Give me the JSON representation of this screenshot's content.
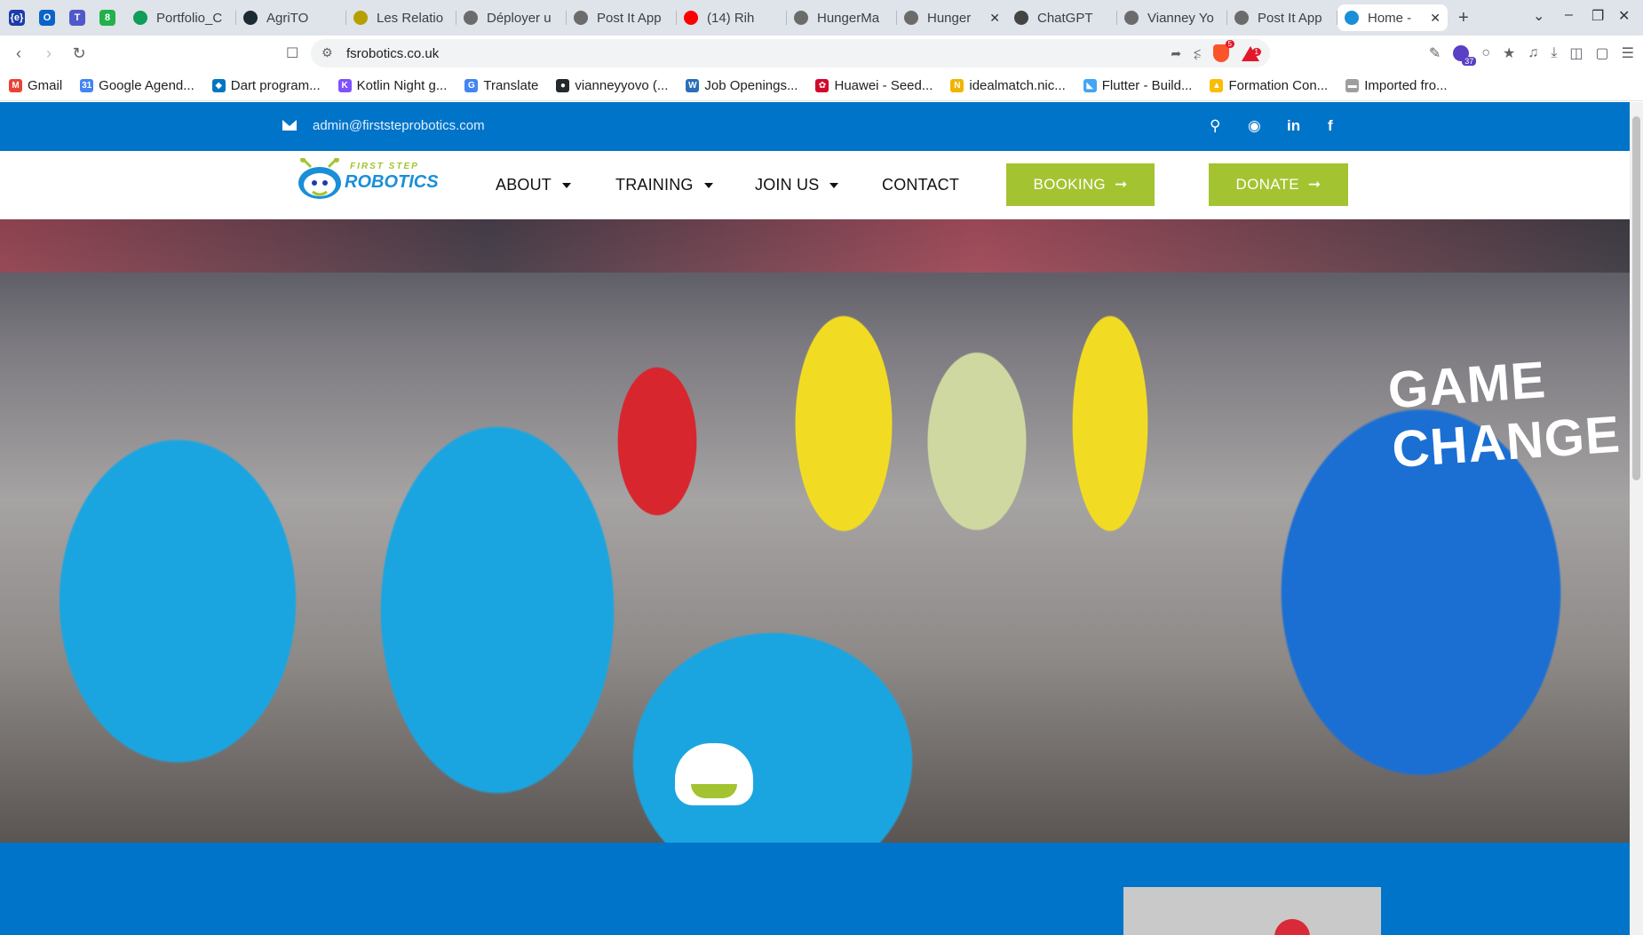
{
  "browser": {
    "pinned_tabs": [
      {
        "name": "pinned-tab-1",
        "icon": "braces-icon",
        "color": "#1a3da8",
        "glyph": "{e}"
      },
      {
        "name": "pinned-tab-2",
        "icon": "outlook-icon",
        "color": "#0a64c8",
        "glyph": "O"
      },
      {
        "name": "pinned-tab-3",
        "icon": "teams-icon",
        "color": "#5059c9",
        "glyph": "T"
      },
      {
        "name": "pinned-tab-4",
        "icon": "green-badge-icon",
        "color": "#22b14c",
        "glyph": "8"
      }
    ],
    "tabs": [
      {
        "label": "Portfolio_C",
        "icon": "sheets-icon",
        "color": "#0f9d58"
      },
      {
        "label": "AgriTO",
        "icon": "agrito-icon",
        "color": "#1b2a33"
      },
      {
        "label": "Les Relatio",
        "icon": "cube-icon",
        "color": "#b5a000"
      },
      {
        "label": "Déployer u",
        "icon": "globe-icon",
        "color": "#6b6b6b"
      },
      {
        "label": "Post It App",
        "icon": "globe-icon",
        "color": "#6b6b6b"
      },
      {
        "label": "(14) Rih",
        "icon": "youtube-icon",
        "color": "#ff0000"
      },
      {
        "label": "HungerMa",
        "icon": "globe-icon",
        "color": "#6b6b6b"
      },
      {
        "label": "Hunger",
        "icon": "globe-icon",
        "color": "#6b6b6b"
      },
      {
        "label": "ChatGPT",
        "icon": "chatgpt-icon",
        "color": "#444444"
      },
      {
        "label": "Vianney Yo",
        "icon": "globe-icon",
        "color": "#6b6b6b"
      },
      {
        "label": "Post It App",
        "icon": "globe-icon",
        "color": "#6b6b6b"
      },
      {
        "label": "Home -",
        "icon": "robot-icon",
        "color": "#1a8fd8"
      }
    ],
    "active_tab_index": 11,
    "new_tab_symbol": "+",
    "window_controls": {
      "dropdown": "⌄",
      "minimize": "–",
      "restore": "❐",
      "close": "✕"
    },
    "url": "fsrobotics.co.uk",
    "brave_shield_count": "5",
    "brave_rewards_count": "1",
    "extension_badge_count": "37",
    "bookmarks": [
      {
        "label": "Gmail",
        "icon": "gmail-icon",
        "color": "#ea4335",
        "glyph": "M"
      },
      {
        "label": "Google Agend...",
        "icon": "calendar-icon",
        "color": "#4285f4",
        "glyph": "31"
      },
      {
        "label": "Dart program...",
        "icon": "dart-icon",
        "color": "#0175c2",
        "glyph": "◆"
      },
      {
        "label": "Kotlin Night g...",
        "icon": "kotlin-icon",
        "color": "#7f52ff",
        "glyph": "K"
      },
      {
        "label": "Translate",
        "icon": "translate-icon",
        "color": "#4285f4",
        "glyph": "G"
      },
      {
        "label": "vianneyyovo (...",
        "icon": "github-icon",
        "color": "#24292e",
        "glyph": "●"
      },
      {
        "label": "Job Openings...",
        "icon": "wfp-icon",
        "color": "#2a6fb8",
        "glyph": "W"
      },
      {
        "label": "Huawei - Seed...",
        "icon": "huawei-icon",
        "color": "#cf0a2c",
        "glyph": "✿"
      },
      {
        "label": "idealmatch.nic...",
        "icon": "idealmatch-icon",
        "color": "#f0b400",
        "glyph": "N"
      },
      {
        "label": "Flutter - Build...",
        "icon": "flutter-icon",
        "color": "#42a5f5",
        "glyph": "◣"
      },
      {
        "label": "Formation Con...",
        "icon": "drive-icon",
        "color": "#fbbc04",
        "glyph": "▲"
      },
      {
        "label": "Imported fro...",
        "icon": "folder-icon",
        "color": "#9e9e9e",
        "glyph": "▬"
      }
    ]
  },
  "site": {
    "top_email": "admin@firststeprobotics.com",
    "logo_top_text": "FIRST STEP",
    "logo_bottom_text": "ROBOTICS",
    "nav": {
      "about": "ABOUT",
      "training": "TRAINING",
      "join_us": "JOIN US",
      "contact": "CONTACT"
    },
    "booking_label": "BOOKING",
    "donate_label": "DONATE",
    "arrow_glyph": "➞",
    "hero_shirt_text": "GAME CHANGE",
    "colors": {
      "brand_blue": "#0074c8",
      "accent_green": "#a4c331"
    }
  }
}
